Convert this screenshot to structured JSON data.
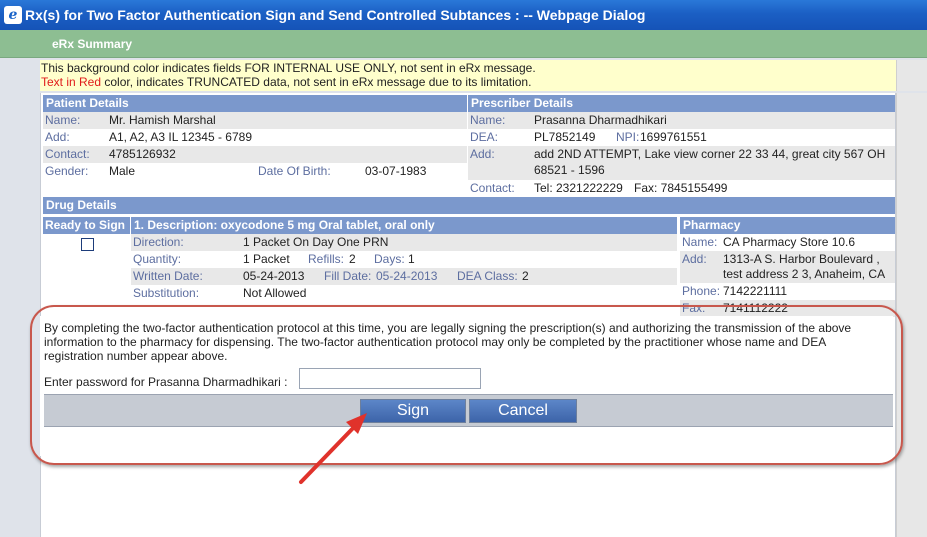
{
  "window": {
    "title": "Rx(s) for Two Factor Authentication Sign and Send Controlled Subtances : -- Webpage Dialog",
    "icon": "ie-icon"
  },
  "erx_summary": "eRx Summary",
  "notice": {
    "line1": "This background color indicates fields FOR INTERNAL USE ONLY, not sent in eRx message.",
    "line2_red": "Text in Red",
    "line2_rest": " color, indicates TRUNCATED data, not sent in eRx message due to its limitation."
  },
  "patient": {
    "header": "Patient Details",
    "name_label": "Name:",
    "name": "Mr. Hamish Marshal",
    "add_label": "Add:",
    "add": "A1, A2, A3 IL 12345 - 6789",
    "contact_label": "Contact:",
    "contact": "4785126932",
    "gender_label": "Gender:",
    "gender": "Male",
    "dob_label": "Date Of Birth:",
    "dob": "03-07-1983"
  },
  "prescriber": {
    "header": "Prescriber Details",
    "name_label": "Name:",
    "name": "Prasanna Dharmadhikari",
    "dea_label": "DEA:",
    "dea": "PL7852149",
    "npi_label": "NPI:",
    "npi": "1699761551",
    "add_label": "Add:",
    "add_line1": "add 2ND ATTEMPT, Lake view corner 22 33 44, great city 567 OH",
    "add_line2": "68521 - 1596",
    "contact_label": "Contact:",
    "tel": "Tel: 2321222229",
    "fax": "Fax: 7845155499"
  },
  "drug": {
    "header": "Drug Details",
    "ready_label": "Ready to Sign",
    "description": "1. Description: oxycodone 5 mg Oral tablet, oral only",
    "direction_label": "Direction:",
    "direction": "1 Packet On Day One PRN",
    "quantity_label": "Quantity:",
    "quantity": "1 Packet",
    "refills_label": "Refills:",
    "refills": "2",
    "days_label": "Days:",
    "days": "1",
    "written_label": "Written Date:",
    "written": "05-24-2013",
    "fill_label": "Fill Date:",
    "fill": "05-24-2013",
    "dea_class_label": "DEA Class:",
    "dea_class": "2",
    "substitution_label": "Substitution:",
    "substitution": "Not Allowed"
  },
  "pharmacy": {
    "header": "Pharmacy",
    "name_label": "Name:",
    "name": "CA Pharmacy Store 10.6",
    "add_label": "Add:",
    "add_line1": "1313-A S. Harbor Boulevard ,",
    "add_line2": "test address 2 3, Anaheim, CA",
    "phone_label": "Phone:",
    "phone": "7142221111",
    "fax_label": "Fax:",
    "fax": "7141112222"
  },
  "auth": {
    "statement": "By completing the two-factor authentication protocol at this time, you are legally signing the prescription(s) and authorizing the transmission of the above information to the pharmacy for dispensing. The two-factor authentication protocol may only be completed by the practitioner whose name and DEA registration number appear above.",
    "password_label": "Enter password for Prasanna Dharmadhikari :",
    "password_value": "",
    "sign_label": "Sign",
    "cancel_label": "Cancel"
  },
  "colors": {
    "title_bar": "#1b5fc4",
    "section_header": "#7b98cc",
    "erx_bar": "#8dbe92",
    "highlight_outline": "#c8584d",
    "arrow": "#e0322b"
  }
}
